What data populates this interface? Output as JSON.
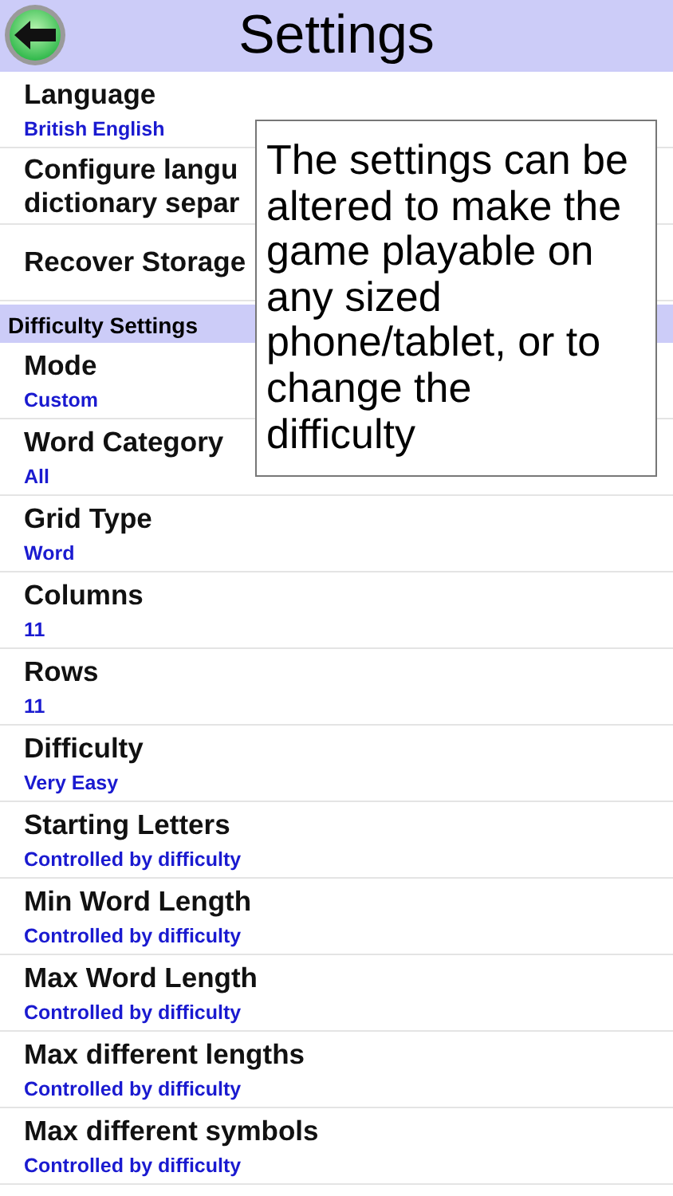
{
  "header": {
    "title": "Settings"
  },
  "rows": [
    {
      "title": "Language",
      "value": "British English"
    },
    {
      "title": "Configure langu\ndictionary separ"
    },
    {
      "title": "Recover Storage"
    }
  ],
  "section": {
    "title": "Difficulty Settings"
  },
  "difficulty_rows": [
    {
      "title": "Mode",
      "value": "Custom"
    },
    {
      "title": "Word Category",
      "value": "All"
    },
    {
      "title": "Grid Type",
      "value": "Word"
    },
    {
      "title": "Columns",
      "value": "11"
    },
    {
      "title": "Rows",
      "value": "11"
    },
    {
      "title": "Difficulty",
      "value": "Very Easy"
    },
    {
      "title": "Starting Letters",
      "value": "Controlled by difficulty"
    },
    {
      "title": "Min Word Length",
      "value": "Controlled by difficulty"
    },
    {
      "title": "Max Word Length",
      "value": "Controlled by difficulty"
    },
    {
      "title": "Max different lengths",
      "value": "Controlled by difficulty"
    },
    {
      "title": "Max different symbols",
      "value": "Controlled by difficulty"
    }
  ],
  "tooltip": {
    "text": "The settings can be\naltered to make the\ngame playable on\nany sized\nphone/tablet, or to\nchange the\ndifficulty"
  }
}
